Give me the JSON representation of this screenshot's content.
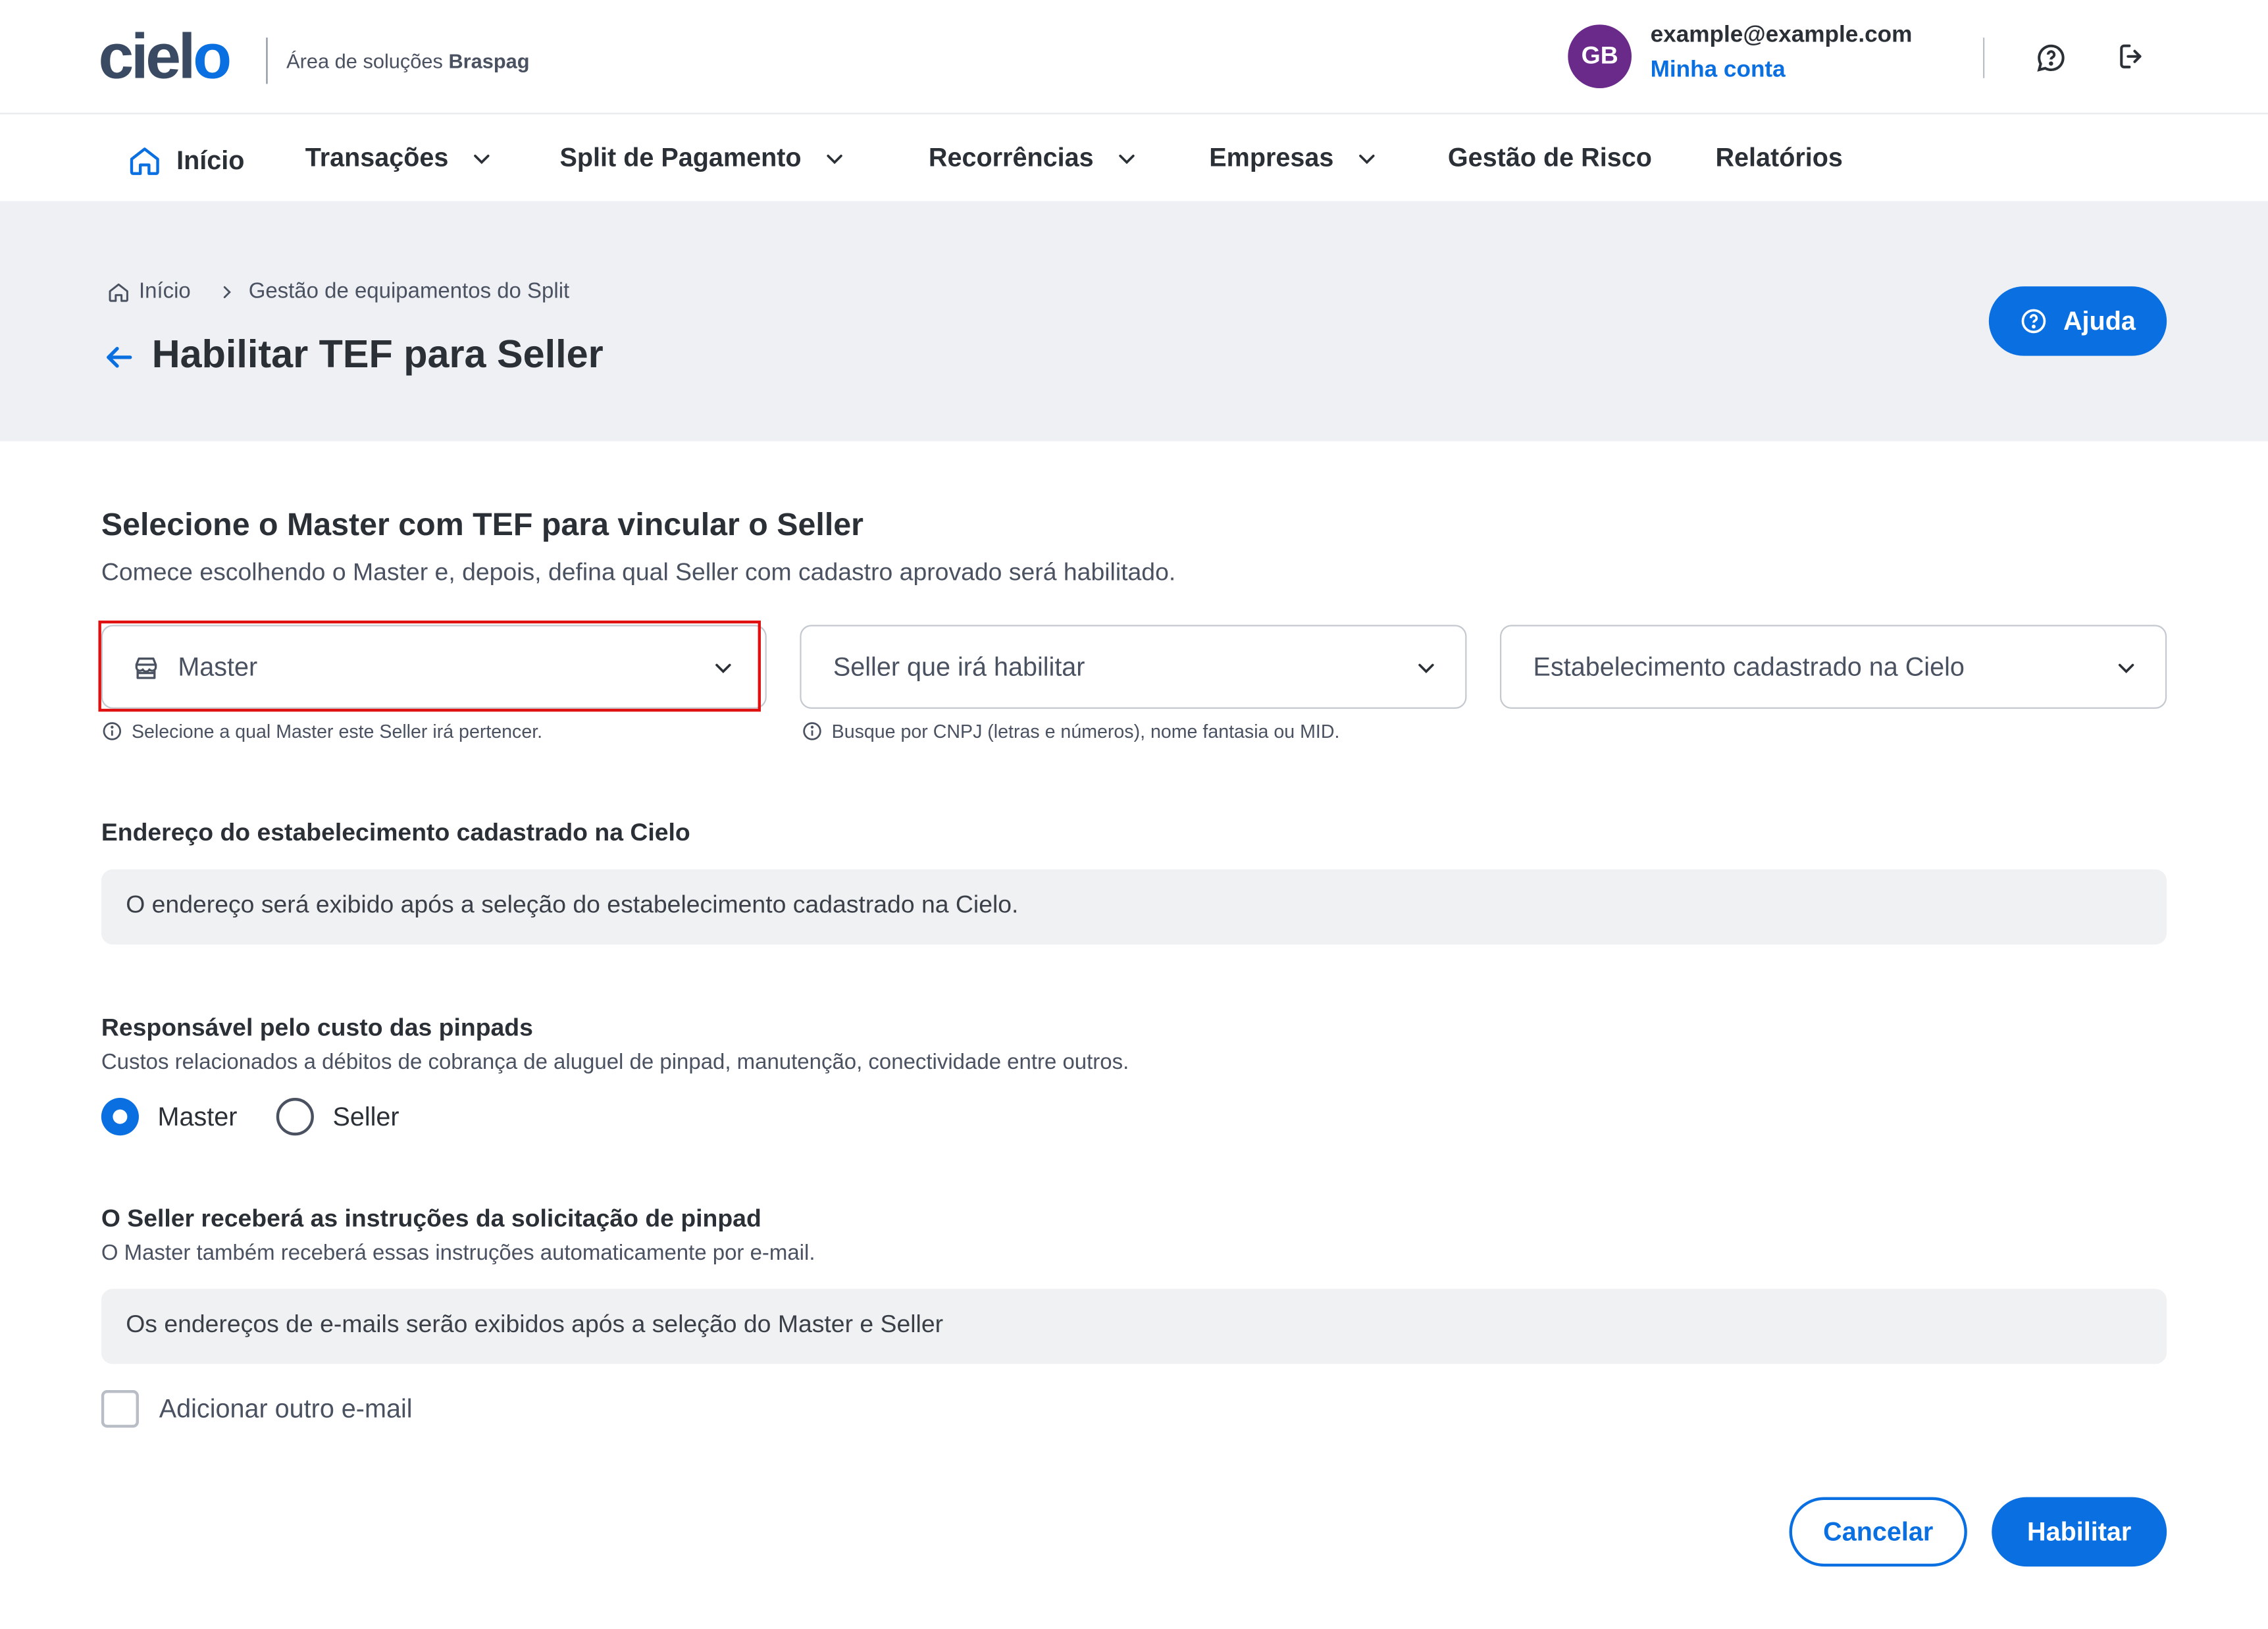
{
  "header": {
    "logo": "cielo",
    "area_prefix": "Área de soluções",
    "area_brand": "Braspag",
    "avatar_initials": "GB",
    "user_email": "example@example.com",
    "account_link": "Minha conta",
    "icons": [
      "chat-help-icon",
      "logout-icon"
    ]
  },
  "nav": {
    "items": [
      {
        "label": "Início",
        "icon": "home-icon",
        "dropdown": false
      },
      {
        "label": "Transações",
        "dropdown": true
      },
      {
        "label": "Split de Pagamento",
        "dropdown": true
      },
      {
        "label": "Recorrências",
        "dropdown": true
      },
      {
        "label": "Empresas",
        "dropdown": true
      },
      {
        "label": "Gestão de Risco",
        "dropdown": false
      },
      {
        "label": "Relatórios",
        "dropdown": false
      }
    ]
  },
  "breadcrumb": {
    "home": "Início",
    "current": "Gestão de equipamentos do Split"
  },
  "page": {
    "title": "Habilitar TEF para Seller",
    "help_label": "Ajuda"
  },
  "form": {
    "section_title": "Selecione o Master com TEF para vincular o Seller",
    "section_desc": "Comece escolhendo o Master e, depois, defina qual Seller com cadastro aprovado será habilitado.",
    "selects": [
      {
        "placeholder": "Master",
        "hint": "Selecione a qual Master este Seller irá pertencer."
      },
      {
        "placeholder": "Seller que irá habilitar",
        "hint": "Busque por CNPJ (letras e números), nome fantasia ou MID."
      },
      {
        "placeholder": "Estabelecimento cadastrado na Cielo",
        "hint": ""
      }
    ],
    "address_label": "Endereço do estabelecimento cadastrado na Cielo",
    "address_value": "O endereço será exibido após a seleção do estabelecimento cadastrado na Cielo.",
    "cost_label": "Responsável pelo custo das pinpads",
    "cost_desc": "Custos relacionados a débitos de cobrança de aluguel de pinpad, manutenção, conectividade entre outros.",
    "cost_options": [
      {
        "label": "Master",
        "selected": true
      },
      {
        "label": "Seller",
        "selected": false
      }
    ],
    "instructions_label": "O Seller receberá as instruções da solicitação de pinpad",
    "instructions_desc": "O Master também receberá essas instruções automaticamente por e-mail.",
    "emails_value": "Os endereços de e-mails serão exibidos após a seleção do Master e Seller",
    "add_email_label": "Adicionar outro e-mail",
    "add_email_checked": false
  },
  "actions": {
    "cancel": "Cancelar",
    "submit": "Habilitar"
  },
  "colors": {
    "primary": "#0a6fe0",
    "avatar": "#6a2a8a",
    "highlight": "#e01010",
    "band": "#eef0f3"
  }
}
